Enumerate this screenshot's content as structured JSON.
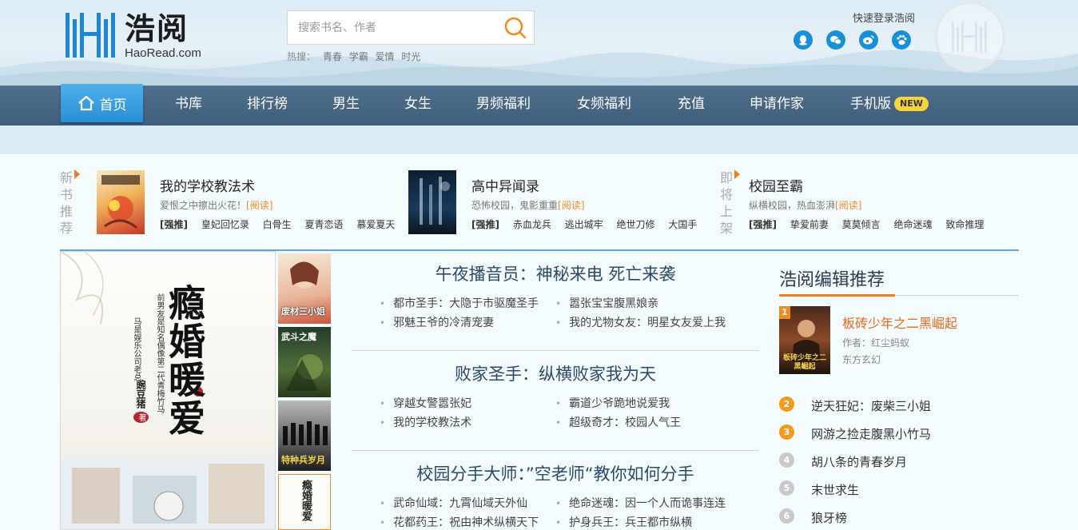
{
  "brand": {
    "name": "浩阅",
    "domain": "HaoRead.com"
  },
  "search": {
    "placeholder": "搜索书名、作者",
    "hot_label": "热搜：",
    "hot_keywords": [
      "青春",
      "学霸",
      "爱情",
      "时光"
    ]
  },
  "header": {
    "quick_login": "快速登录浩阅"
  },
  "nav": {
    "home": "首页",
    "items": [
      "书库",
      "排行榜",
      "男生",
      "女生",
      "男频福利",
      "女频福利",
      "充值",
      "申请作家",
      "手机版"
    ],
    "new_badge": "NEW"
  },
  "strip": {
    "new_label": "新书推荐",
    "upcoming_label": "即将上架",
    "read_label": "[阅读]",
    "strong_label": "[强推]",
    "books": [
      {
        "title": "我的学校教法术",
        "desc": "爱恨之中擦出火花！",
        "tags": [
          "皇妃回忆录",
          "白骨生",
          "夏青恋语",
          "慕爱夏天"
        ]
      },
      {
        "title": "高中异闻录",
        "desc": "恐怖校园，鬼影重重",
        "tags": [
          "赤血龙兵",
          "逃出城牢",
          "绝世刀修",
          "大国手"
        ]
      },
      {
        "title": "校园至霸",
        "desc": "纵横校园，热血澎湃",
        "tags": [
          "挚爱前妻",
          "莫莫倾言",
          "绝命迷魂",
          "致命推理"
        ]
      }
    ]
  },
  "feature": {
    "cover_title": "瘾婚暖爱",
    "cover_tagline": "前男友是知名偶像第二代青梅竹马",
    "cover_sub": "马是娱乐公司老总",
    "cover_author": "豌豆猪",
    "cover_author_suffix": "著",
    "thumb_titles": [
      "废材三小姐",
      "武斗之魔",
      "特种兵岁月",
      "瘾婚暖爱"
    ]
  },
  "topics": [
    {
      "title": "午夜播音员：神秘来电 死亡来袭",
      "links": [
        "都市圣手：大隐于市驱魔圣手",
        "嚣张宝宝腹黑娘亲",
        "邪魅王爷的冷清宠妻",
        "我的尤物女友：明星女友爱上我"
      ]
    },
    {
      "title": "败家圣手：纵横败家我为天",
      "links": [
        "穿越女警嚣张妃",
        "霸道少爷跪地说爱我",
        "我的学校教法术",
        "超级奇才：校园人气王"
      ]
    },
    {
      "title": "校园分手大师：”空老师“教你如何分手",
      "links": [
        "武命仙域：九霄仙域天外仙",
        "绝命迷魂：因一个人而诡事连连",
        "花都药王：祝由神术纵横天下",
        "护身兵王：兵王都市纵横"
      ]
    }
  ],
  "recommend": {
    "title": "浩阅编辑推荐",
    "top": {
      "rank": "1",
      "title": "板砖少年之二黑崛起",
      "author": "作者：红尘蚂蚁",
      "category": "东方玄幻",
      "cover_text": "板砖少年之二黑崛起"
    },
    "list": [
      {
        "rank": "2",
        "title": "逆天狂妃：废柴三小姐",
        "color": "#f39a1d"
      },
      {
        "rank": "3",
        "title": "网游之捡走腹黑小竹马",
        "color": "#f39a1d"
      },
      {
        "rank": "4",
        "title": "胡八条的青春岁月",
        "color": "#c9c9c9"
      },
      {
        "rank": "5",
        "title": "末世求生",
        "color": "#c9c9c9"
      },
      {
        "rank": "6",
        "title": "狼牙榜",
        "color": "#c9c9c9"
      }
    ]
  }
}
